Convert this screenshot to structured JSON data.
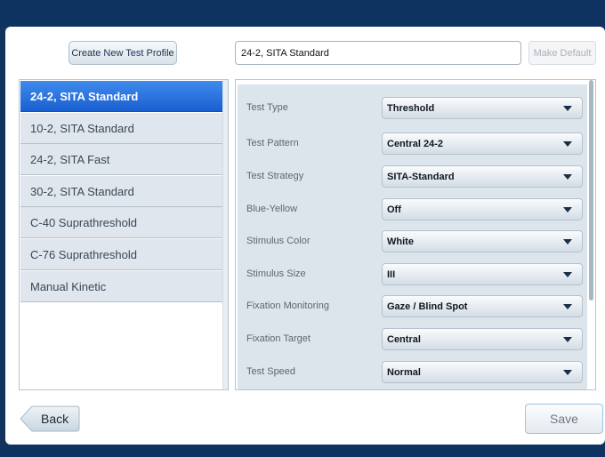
{
  "toolbar": {
    "create_profile_label": "Create New Test Profile",
    "profile_name_value": "24-2, SITA Standard",
    "make_default_label": "Make Default"
  },
  "profiles": [
    {
      "label": "24-2, SITA Standard",
      "selected": true
    },
    {
      "label": "10-2, SITA Standard",
      "selected": false
    },
    {
      "label": "24-2, SITA Fast",
      "selected": false
    },
    {
      "label": "30-2, SITA Standard",
      "selected": false
    },
    {
      "label": "C-40 Suprathreshold",
      "selected": false
    },
    {
      "label": "C-76 Suprathreshold",
      "selected": false
    },
    {
      "label": "Manual Kinetic",
      "selected": false
    }
  ],
  "settings": [
    {
      "label": "Test Type",
      "value": "Threshold"
    },
    {
      "label": "Test Pattern",
      "value": "Central 24-2"
    },
    {
      "label": "Test Strategy",
      "value": "SITA-Standard"
    },
    {
      "label": "Blue-Yellow",
      "value": "Off"
    },
    {
      "label": "Stimulus Color",
      "value": "White"
    },
    {
      "label": "Stimulus Size",
      "value": "III"
    },
    {
      "label": "Fixation Monitoring",
      "value": "Gaze / Blind Spot"
    },
    {
      "label": "Fixation Target",
      "value": "Central"
    },
    {
      "label": "Test Speed",
      "value": "Normal"
    }
  ],
  "footer": {
    "back_label": "Back",
    "save_label": "Save"
  },
  "colors": {
    "selection_blue": "#1a5fd1",
    "frame_navy": "#0f3361"
  }
}
